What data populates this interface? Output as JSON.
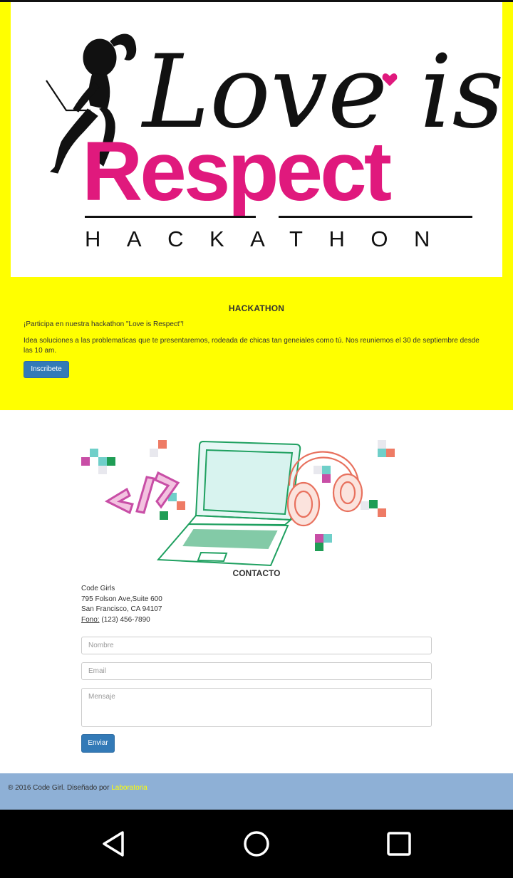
{
  "logo": {
    "script_text": "Love is",
    "main_text": "Respect",
    "sub_text": "HACKATHON"
  },
  "hackathon": {
    "title": "HACKATHON",
    "intro": "¡Participa en nuestra hackathon \"Love is Respect\"!",
    "description": "Idea soluciones a las problematicas que te presentaremos, rodeada de chicas tan geneiales como tú. Nos reuniemos el 30 de septiembre desde las 10 am.",
    "button_label": "Inscribete"
  },
  "contact": {
    "title": "CONTACTO",
    "name": "Code Girls",
    "address_line1": "795 Folson Ave,Suite 600",
    "address_line2": "San Francisco, CA 94107",
    "phone_label": "Fono:",
    "phone": "(123) 456-7890",
    "form": {
      "name_placeholder": "Nombre",
      "email_placeholder": "Email",
      "message_placeholder": "Mensaje",
      "submit_label": "Enviar"
    }
  },
  "footer": {
    "text": "® 2016 Code Girl. Diseñado por ",
    "link": "Laboratoria"
  },
  "colors": {
    "yellow": "#ffff00",
    "pink": "#e0197d",
    "primary_button": "#337ab7",
    "footer_bg": "#8eb0d6"
  },
  "icons": [
    "back-icon",
    "home-icon",
    "recents-icon",
    "laptop-icon",
    "headphones-icon",
    "code-icon"
  ]
}
